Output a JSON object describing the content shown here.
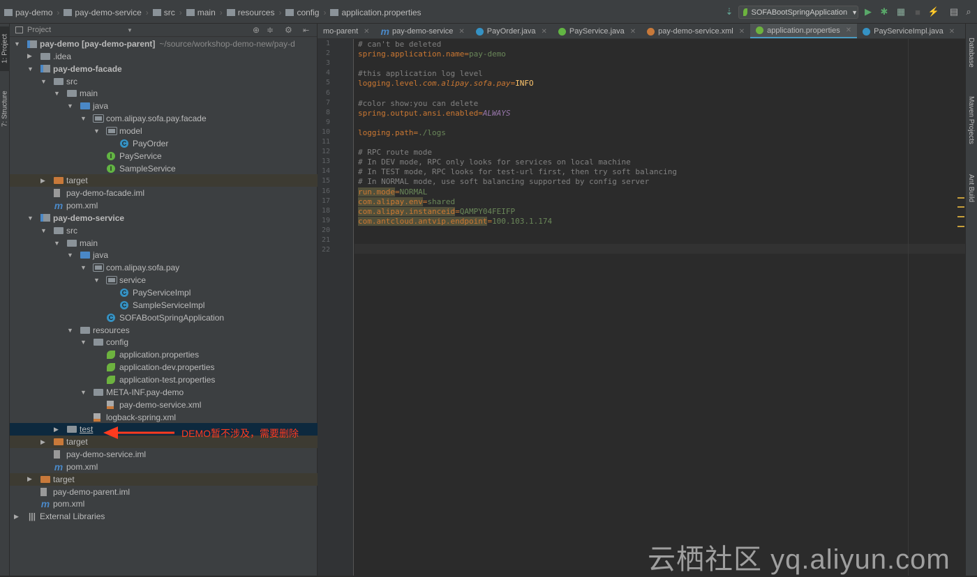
{
  "breadcrumbs": [
    "pay-demo",
    "pay-demo-service",
    "src",
    "main",
    "resources",
    "config",
    "application.properties"
  ],
  "run_config": "SOFABootSpringApplication",
  "toolbar_icons": [
    "build-icon",
    "run-icon",
    "debug-icon",
    "coverage-icon",
    "stop-icon",
    "attach-icon",
    "project-structure-icon",
    "search-icon"
  ],
  "left_tool_tabs": [
    "1: Project",
    "7: Structure"
  ],
  "right_tool_tabs": [
    "Database",
    "Maven Projects",
    "Ant Build"
  ],
  "project_panel": {
    "title": "Project"
  },
  "tree": [
    {
      "label": "pay-demo [pay-demo-parent]",
      "extra": "~/source/workshop-demo-new/pay-d",
      "level": 0,
      "state": "open",
      "icon": "module",
      "bold": true
    },
    {
      "label": ".idea",
      "level": 1,
      "state": "closed",
      "icon": "folder"
    },
    {
      "label": "pay-demo-facade",
      "level": 1,
      "state": "open",
      "icon": "module",
      "bold": true
    },
    {
      "label": "src",
      "level": 2,
      "state": "open",
      "icon": "folder"
    },
    {
      "label": "main",
      "level": 3,
      "state": "open",
      "icon": "folder"
    },
    {
      "label": "java",
      "level": 4,
      "state": "open",
      "icon": "src"
    },
    {
      "label": "com.alipay.sofa.pay.facade",
      "level": 5,
      "state": "open",
      "icon": "pkg"
    },
    {
      "label": "model",
      "level": 6,
      "state": "open",
      "icon": "pkg"
    },
    {
      "label": "PayOrder",
      "level": 7,
      "icon": "class"
    },
    {
      "label": "PayService",
      "level": 6,
      "icon": "iface"
    },
    {
      "label": "SampleService",
      "level": 6,
      "icon": "iface"
    },
    {
      "label": "target",
      "level": 2,
      "state": "closed",
      "icon": "excl",
      "hl": true
    },
    {
      "label": "pay-demo-facade.iml",
      "level": 2,
      "icon": "iml"
    },
    {
      "label": "pom.xml",
      "level": 2,
      "icon": "maven"
    },
    {
      "label": "pay-demo-service",
      "level": 1,
      "state": "open",
      "icon": "module",
      "bold": true
    },
    {
      "label": "src",
      "level": 2,
      "state": "open",
      "icon": "folder"
    },
    {
      "label": "main",
      "level": 3,
      "state": "open",
      "icon": "folder"
    },
    {
      "label": "java",
      "level": 4,
      "state": "open",
      "icon": "src"
    },
    {
      "label": "com.alipay.sofa.pay",
      "level": 5,
      "state": "open",
      "icon": "pkg"
    },
    {
      "label": "service",
      "level": 6,
      "state": "open",
      "icon": "pkg"
    },
    {
      "label": "PayServiceImpl",
      "level": 7,
      "icon": "class"
    },
    {
      "label": "SampleServiceImpl",
      "level": 7,
      "icon": "class"
    },
    {
      "label": "SOFABootSpringApplication",
      "level": 6,
      "icon": "class"
    },
    {
      "label": "resources",
      "level": 4,
      "state": "open",
      "icon": "folder"
    },
    {
      "label": "config",
      "level": 5,
      "state": "open",
      "icon": "folder"
    },
    {
      "label": "application.properties",
      "level": 6,
      "icon": "spring"
    },
    {
      "label": "application-dev.properties",
      "level": 6,
      "icon": "spring"
    },
    {
      "label": "application-test.properties",
      "level": 6,
      "icon": "spring"
    },
    {
      "label": "META-INF.pay-demo",
      "level": 5,
      "state": "open",
      "icon": "folder"
    },
    {
      "label": "pay-demo-service.xml",
      "level": 6,
      "icon": "xml"
    },
    {
      "label": "logback-spring.xml",
      "level": 5,
      "icon": "xml"
    },
    {
      "label": "test",
      "level": 3,
      "state": "closed",
      "icon": "folder",
      "selected": true
    },
    {
      "label": "target",
      "level": 2,
      "state": "closed",
      "icon": "excl",
      "hl": true
    },
    {
      "label": "pay-demo-service.iml",
      "level": 2,
      "icon": "iml"
    },
    {
      "label": "pom.xml",
      "level": 2,
      "icon": "maven"
    },
    {
      "label": "target",
      "level": 1,
      "state": "closed",
      "icon": "excl",
      "hl": true
    },
    {
      "label": "pay-demo-parent.iml",
      "level": 1,
      "icon": "iml"
    },
    {
      "label": "pom.xml",
      "level": 1,
      "icon": "maven"
    },
    {
      "label": "External Libraries",
      "level": 0,
      "state": "closed",
      "icon": "lib"
    }
  ],
  "tabs": [
    {
      "label": "mo-parent",
      "color": ""
    },
    {
      "label": "pay-demo-service",
      "color": "maven"
    },
    {
      "label": "PayOrder.java",
      "color": "#3592c4"
    },
    {
      "label": "PayService.java",
      "color": "#62b543"
    },
    {
      "label": "pay-demo-service.xml",
      "color": "#c8793a"
    },
    {
      "label": "application.properties",
      "color": "#6db33f",
      "active": true
    },
    {
      "label": "PayServiceImpl.java",
      "color": "#3592c4"
    }
  ],
  "tab_overflow": "≡1",
  "code_lines": [
    [
      [
        "comment",
        "# can't be deleted"
      ]
    ],
    [
      [
        "key",
        "spring.application.name"
      ],
      [
        "eq",
        "="
      ],
      [
        "val",
        "pay-demo"
      ]
    ],
    [],
    [
      [
        "comment",
        "#this application log level"
      ]
    ],
    [
      [
        "key",
        "logging.level."
      ],
      [
        "it",
        "com.alipay.sofa.pay"
      ],
      [
        "eq",
        "="
      ],
      [
        "const",
        "INFO"
      ]
    ],
    [],
    [
      [
        "comment",
        "#color show:you can delete"
      ]
    ],
    [
      [
        "key",
        "spring.output.ansi.enabled"
      ],
      [
        "eq",
        "="
      ],
      [
        "purple",
        "ALWAYS"
      ]
    ],
    [],
    [
      [
        "key",
        "logging.path"
      ],
      [
        "eq",
        "="
      ],
      [
        "val",
        "./logs"
      ]
    ],
    [],
    [
      [
        "comment",
        "# RPC route mode"
      ]
    ],
    [
      [
        "comment",
        "# In DEV mode, RPC only looks for services on local machine"
      ]
    ],
    [
      [
        "comment",
        "# In TEST mode, RPC looks for test-url first, then try soft balancing"
      ]
    ],
    [
      [
        "comment",
        "# In NORMAL mode, use soft balancing supported by config server"
      ]
    ],
    [
      [
        "key hlk",
        "run.mode"
      ],
      [
        "eq",
        "="
      ],
      [
        "val",
        "NORMAL"
      ]
    ],
    [
      [
        "key hlk",
        "com.alipay.env"
      ],
      [
        "eq",
        "="
      ],
      [
        "val",
        "shared"
      ]
    ],
    [
      [
        "key hlk",
        "com.alipay.instanceid"
      ],
      [
        "eq",
        "="
      ],
      [
        "val",
        "QAMPY04FEIFP"
      ]
    ],
    [
      [
        "key hlk",
        "com.antcloud.antvip.endpoint"
      ],
      [
        "eq",
        "="
      ],
      [
        "val",
        "100.103.1.174"
      ]
    ],
    [],
    [],
    []
  ],
  "annotation": {
    "text": "DEMO暂不涉及，需要删除",
    "color": "#ff3b1f"
  },
  "watermark": "云栖社区 yq.aliyun.com"
}
